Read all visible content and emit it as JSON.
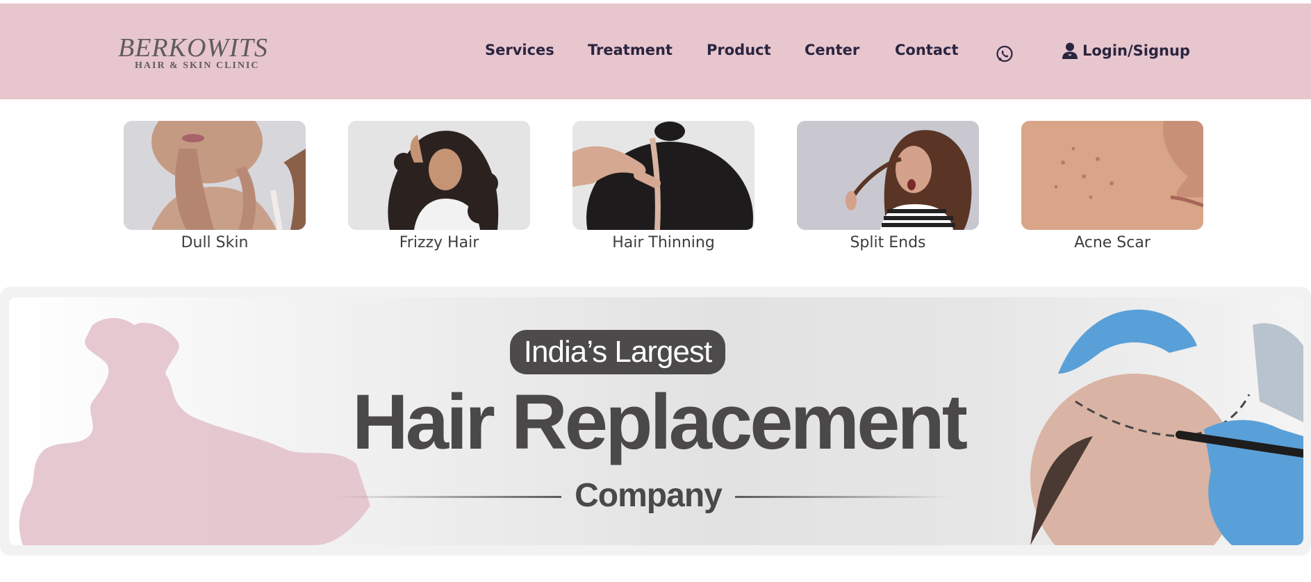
{
  "header": {
    "logo": {
      "main": "BERKOWITS",
      "sub": "HAIR & SKIN CLINIC"
    },
    "nav": [
      {
        "label": "Services"
      },
      {
        "label": "Treatment"
      },
      {
        "label": "Product"
      },
      {
        "label": "Center"
      },
      {
        "label": "Contact"
      }
    ],
    "whatsapp_icon": "whatsapp-icon",
    "login": {
      "icon": "user-icon",
      "label": "Login/Signup"
    }
  },
  "concerns": [
    {
      "label": "Dull Skin"
    },
    {
      "label": "Frizzy Hair"
    },
    {
      "label": "Hair Thinning"
    },
    {
      "label": "Split Ends"
    },
    {
      "label": "Acne Scar"
    }
  ],
  "banner": {
    "pill": "India’s Largest",
    "headline": "Hair Replacement",
    "subhead": "Company"
  },
  "colors": {
    "header_bg": "#e8c6ce",
    "nav_text": "#2a2540",
    "banner_text": "#4a4849",
    "map_pink": "#e3c2cb"
  }
}
